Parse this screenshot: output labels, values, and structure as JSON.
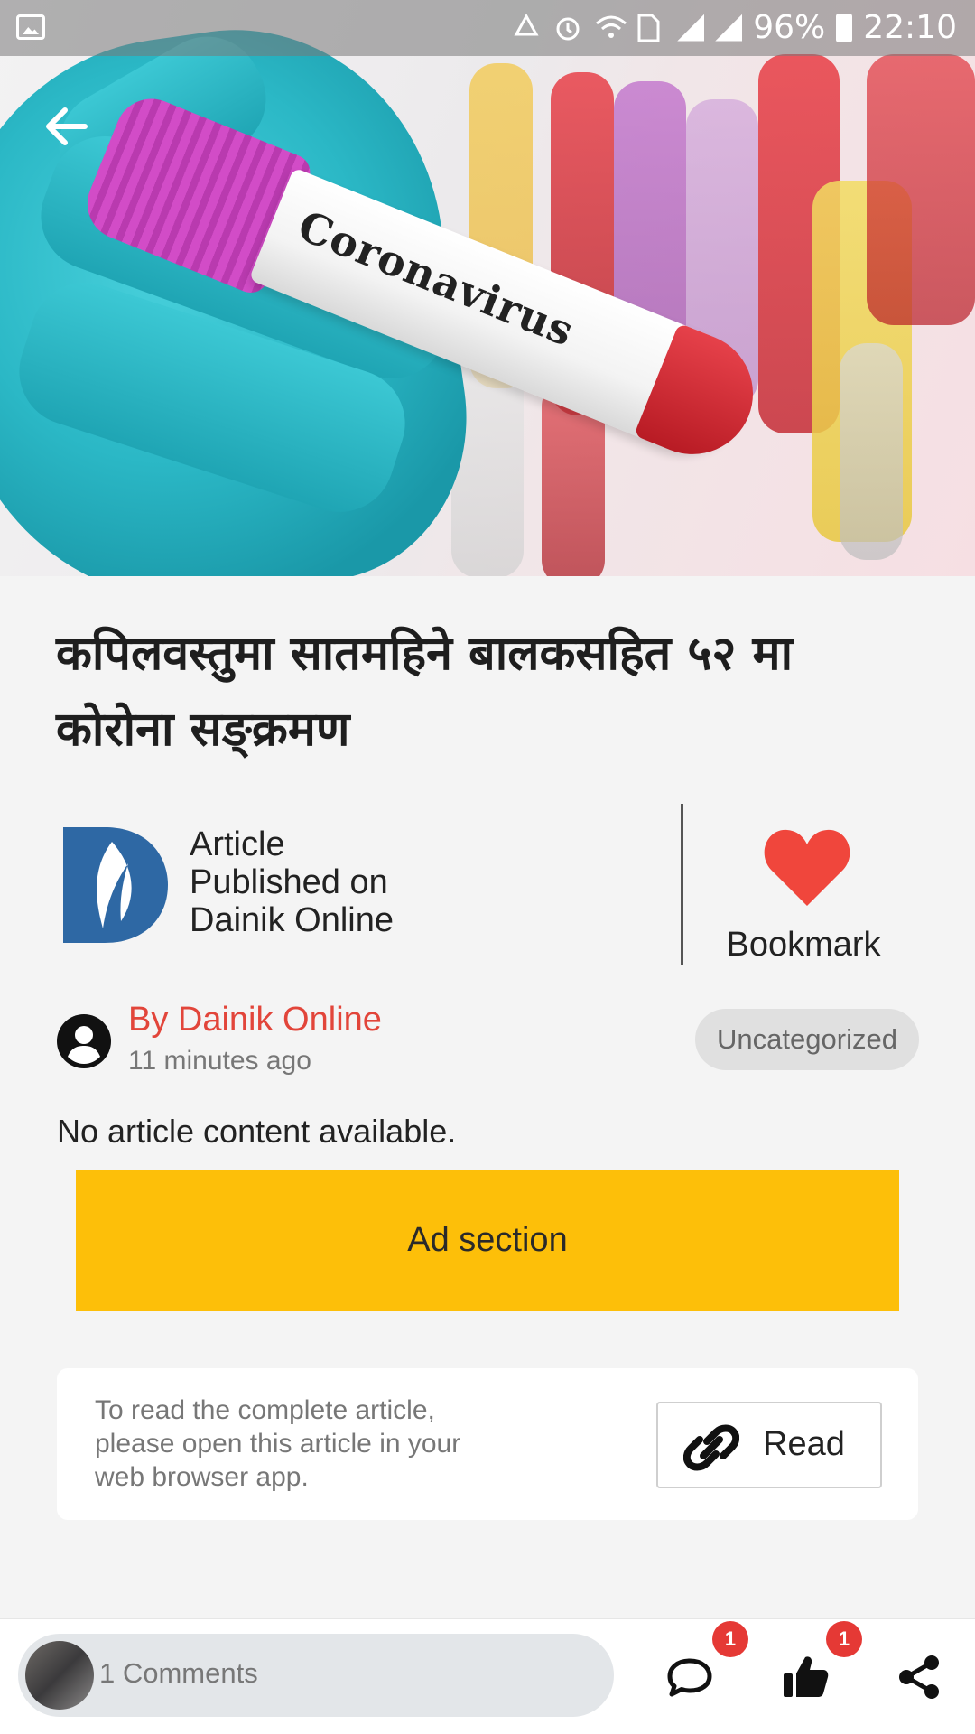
{
  "status_bar": {
    "battery": "96%",
    "time": "22:10"
  },
  "hero": {
    "tube_label": "Coronavirus"
  },
  "article": {
    "title": "कपिलवस्तुमा सातमहिने बालकसहित ५२ मा कोरोना सङ्क्रमण",
    "source_line1": "Article",
    "source_line2": "Published on",
    "source_line3": "Dainik Online",
    "bookmark_label": "Bookmark",
    "author": "By Dainik Online",
    "time_ago": "11 minutes ago",
    "category": "Uncategorized",
    "no_content": "No article content available.",
    "ad_label": "Ad section",
    "read_prompt": "To read the complete article, please open this article in your web browser app.",
    "read_button": "Read"
  },
  "bottom_bar": {
    "comments_label": "1 Comments",
    "comment_badge": "1",
    "like_badge": "1"
  },
  "colors": {
    "accent_red": "#e2453a",
    "ad_yellow": "#fdbf09",
    "heart_red": "#f0463c"
  }
}
